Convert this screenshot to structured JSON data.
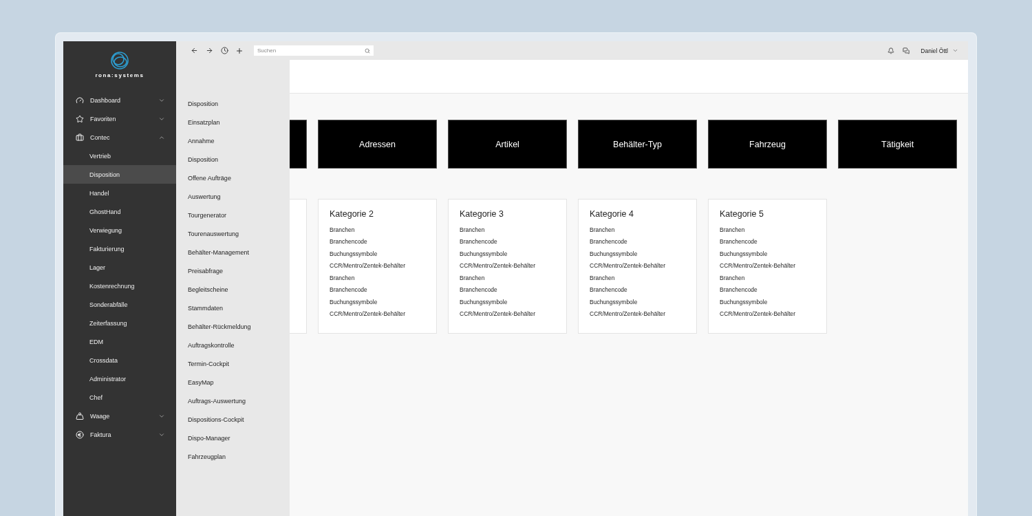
{
  "sidebar": {
    "logo_text": "rona:systems",
    "items": [
      {
        "label": "Dashboard",
        "expanded": false,
        "selected": false
      },
      {
        "label": "Favoriten",
        "expanded": false,
        "selected": false
      },
      {
        "label": "Contec",
        "expanded": true,
        "selected": false,
        "children": [
          {
            "label": "Vertrieb",
            "selected": false
          },
          {
            "label": "Disposition",
            "selected": true
          },
          {
            "label": "Handel",
            "selected": false
          },
          {
            "label": "GhostHand",
            "selected": false
          },
          {
            "label": "Verwiegung",
            "selected": false
          },
          {
            "label": "Fakturierung",
            "selected": false
          },
          {
            "label": "Lager",
            "selected": false
          },
          {
            "label": "Kostenrechnung",
            "selected": false
          },
          {
            "label": "Sonderabfälle",
            "selected": false
          },
          {
            "label": "Zeiterfassung",
            "selected": false
          },
          {
            "label": "EDM",
            "selected": false
          },
          {
            "label": "Crossdata",
            "selected": false
          },
          {
            "label": "Administrator",
            "selected": false
          },
          {
            "label": "Chef",
            "selected": false
          }
        ]
      },
      {
        "label": "Waage",
        "expanded": false,
        "selected": false
      },
      {
        "label": "Faktura",
        "expanded": false,
        "selected": false
      }
    ]
  },
  "toolbar": {
    "search": {
      "placeholder": "Suchen"
    },
    "user": "Daniel Öttl"
  },
  "flyout": {
    "items": [
      "Disposition",
      "Einsatzplan",
      "Annahme",
      "Disposition",
      "Offene Aufträge",
      "Auswertung",
      "Tourgenerator",
      "Tourenauswertung",
      "Behälter-Management",
      "Preisabfrage",
      "Begleitscheine",
      "Stammdaten",
      "Behälter-Rückmeldung",
      "Auftragskontrolle",
      "Termin-Cockpit",
      "EasyMap",
      "Auftrags-Auswertung",
      "Dispositions-Cockpit",
      "Dispo-Manager",
      "Fahrzeugplan"
    ]
  },
  "tiles": [
    "Adressen",
    "Artikel",
    "Behälter-Typ",
    "Fahrzeug",
    "Tätigkeit"
  ],
  "cards": [
    {
      "title": "Kategorie 2",
      "links": [
        "Branchen",
        "Branchencode",
        "Buchungssymbole",
        "CCR/Mentro/Zentek-Behälter",
        "Branchen",
        "Branchencode",
        "Buchungssymbole",
        "CCR/Mentro/Zentek-Behälter"
      ]
    },
    {
      "title": "Kategorie 3",
      "links": [
        "Branchen",
        "Branchencode",
        "Buchungssymbole",
        "CCR/Mentro/Zentek-Behälter",
        "Branchen",
        "Branchencode",
        "Buchungssymbole",
        "CCR/Mentro/Zentek-Behälter"
      ]
    },
    {
      "title": "Kategorie 4",
      "links": [
        "Branchen",
        "Branchencode",
        "Buchungssymbole",
        "CCR/Mentro/Zentek-Behälter",
        "Branchen",
        "Branchencode",
        "Buchungssymbole",
        "CCR/Mentro/Zentek-Behälter"
      ]
    },
    {
      "title": "Kategorie 5",
      "links": [
        "Branchen",
        "Branchencode",
        "Buchungssymbole",
        "CCR/Mentro/Zentek-Behälter",
        "Branchen",
        "Branchencode",
        "Buchungssymbole",
        "CCR/Mentro/Zentek-Behälter"
      ]
    }
  ]
}
